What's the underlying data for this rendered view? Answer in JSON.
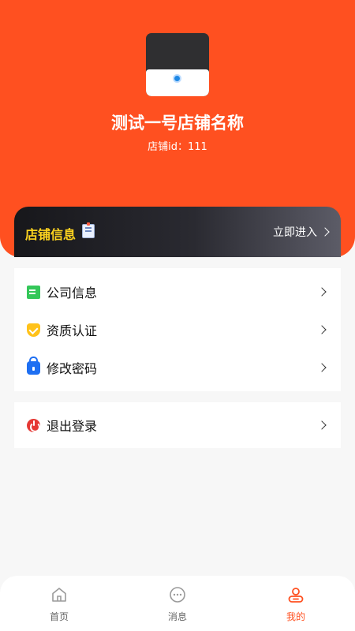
{
  "store": {
    "name": "测试一号店铺名称",
    "id_line": "店铺id：111"
  },
  "info_bar": {
    "title": "店铺信息",
    "enter_label": "立即进入"
  },
  "menu": [
    {
      "label": "公司信息",
      "icon": "company-doc-icon"
    },
    {
      "label": "资质认证",
      "icon": "shield-check-icon"
    },
    {
      "label": "修改密码",
      "icon": "lock-icon"
    }
  ],
  "logout": {
    "label": "退出登录",
    "icon": "power-icon"
  },
  "tabs": [
    {
      "label": "首页",
      "icon": "home-icon"
    },
    {
      "label": "消息",
      "icon": "message-icon"
    },
    {
      "label": "我的",
      "icon": "user-icon",
      "active": true
    }
  ],
  "colors": {
    "brand": "#ff5020",
    "info_title": "#ffd51f",
    "tab_inactive": "#666666"
  }
}
